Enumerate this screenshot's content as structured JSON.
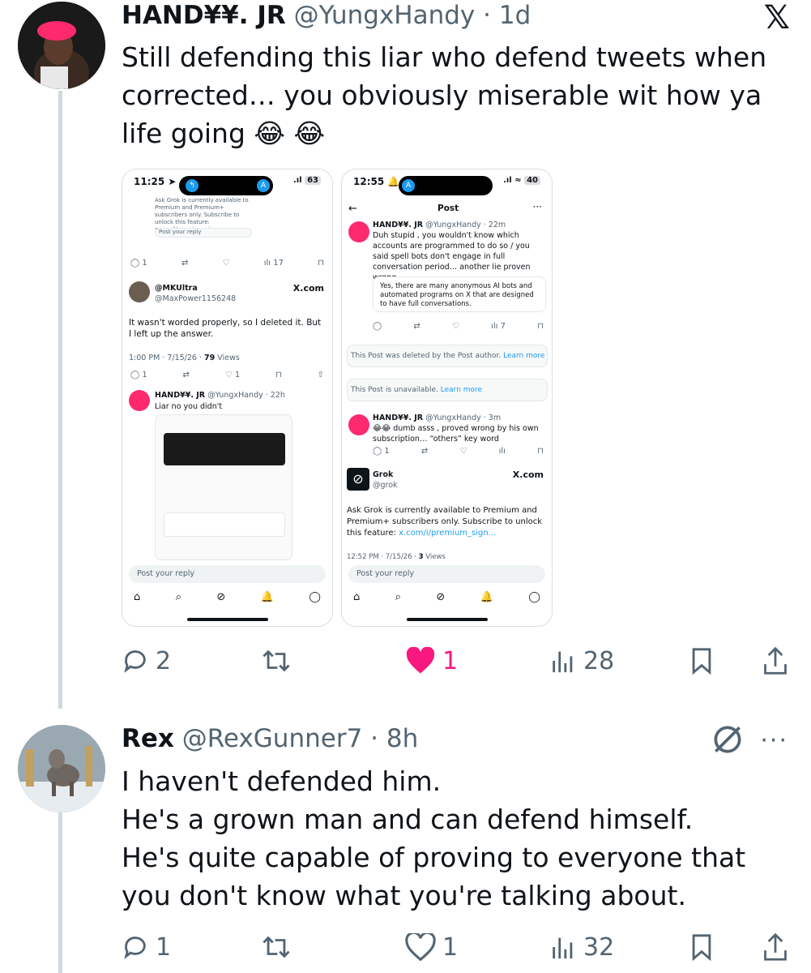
{
  "app": {
    "logo_icon": "x-logo-icon"
  },
  "tweet1": {
    "display_name": "HAND¥¥. JR",
    "handle": "@YungxHandy",
    "time": "· 1d",
    "text": "Still defending this liar who defend tweets when corrected… you obviously miserable wit how ya life going 😂 😂",
    "actions": {
      "replies": "2",
      "retweets": "",
      "likes": "1",
      "views": "28"
    },
    "liked": true,
    "accent_like": "#f91880"
  },
  "screenshot1": {
    "time": "11:25",
    "battery": "63",
    "top_text": "Ask Grok is currently available to Premium and Premium+ subscribers only. Subscribe to unlock this feature: x.com/i/premium_sign...",
    "reply_placeholder": "Post your reply",
    "action_views": "17",
    "user_name": "@MKUltra",
    "user_handle": "@MaxPower1156248",
    "source": "X.com",
    "body": "It wasn't worded properly, so I deleted it. But I left up the answer.",
    "timestamp": "1:00 PM · 7/15/26 · ",
    "views_count": "79",
    "views_label": "Views",
    "reply_count": "1",
    "like_count": "1",
    "reply_user": "HAND¥¥. JR",
    "reply_handle": "@YungxHandy · 22h",
    "reply_text": "Liar no you didn't",
    "bottom_placeholder": "Post your reply"
  },
  "screenshot2": {
    "time": "12:55",
    "battery": "40",
    "title": "Post",
    "user": "HAND¥¥. JR",
    "handle": "@YungxHandy · 22m",
    "text": "Duh stupid , you wouldn't know which accounts are programmed to do so / you said spell bots don't engage in full conversation period… another lie proven wrong",
    "quote": "Yes, there are many anonymous AI bots and automated programs on X that are designed to have full conversations.",
    "views": "7",
    "deleted": "This Post was deleted by the Post author.",
    "unavailable": "This Post is unavailable.",
    "learn_more": "Learn more",
    "reply2_handle": "@YungxHandy · 3m",
    "reply2_text": "😂😂 dumb asss , proved wrong by his own subscription… “others” key word",
    "reply2_count": "1",
    "grok_name": "Grok",
    "grok_handle": "@grok",
    "source": "X.com",
    "grok_text": "Ask Grok is currently available to Premium and Premium+ subscribers only. Subscribe to unlock this feature: ",
    "grok_link": "x.com/i/premium_sign...",
    "grok_time": "12:52 PM · 7/15/26 · ",
    "grok_views": "3",
    "grok_views_label": "Views",
    "reply_placeholder": "Post your reply"
  },
  "tweet2": {
    "display_name": "Rex",
    "handle": "@RexGunner7",
    "time": "· 8h",
    "text_lines": [
      "I haven't defended him.",
      "He's a grown man and can defend himself.",
      "He's quite capable of proving to everyone that",
      "you don't know what you're talking about."
    ],
    "actions": {
      "replies": "1",
      "retweets": "",
      "likes": "1",
      "views": "32"
    }
  }
}
